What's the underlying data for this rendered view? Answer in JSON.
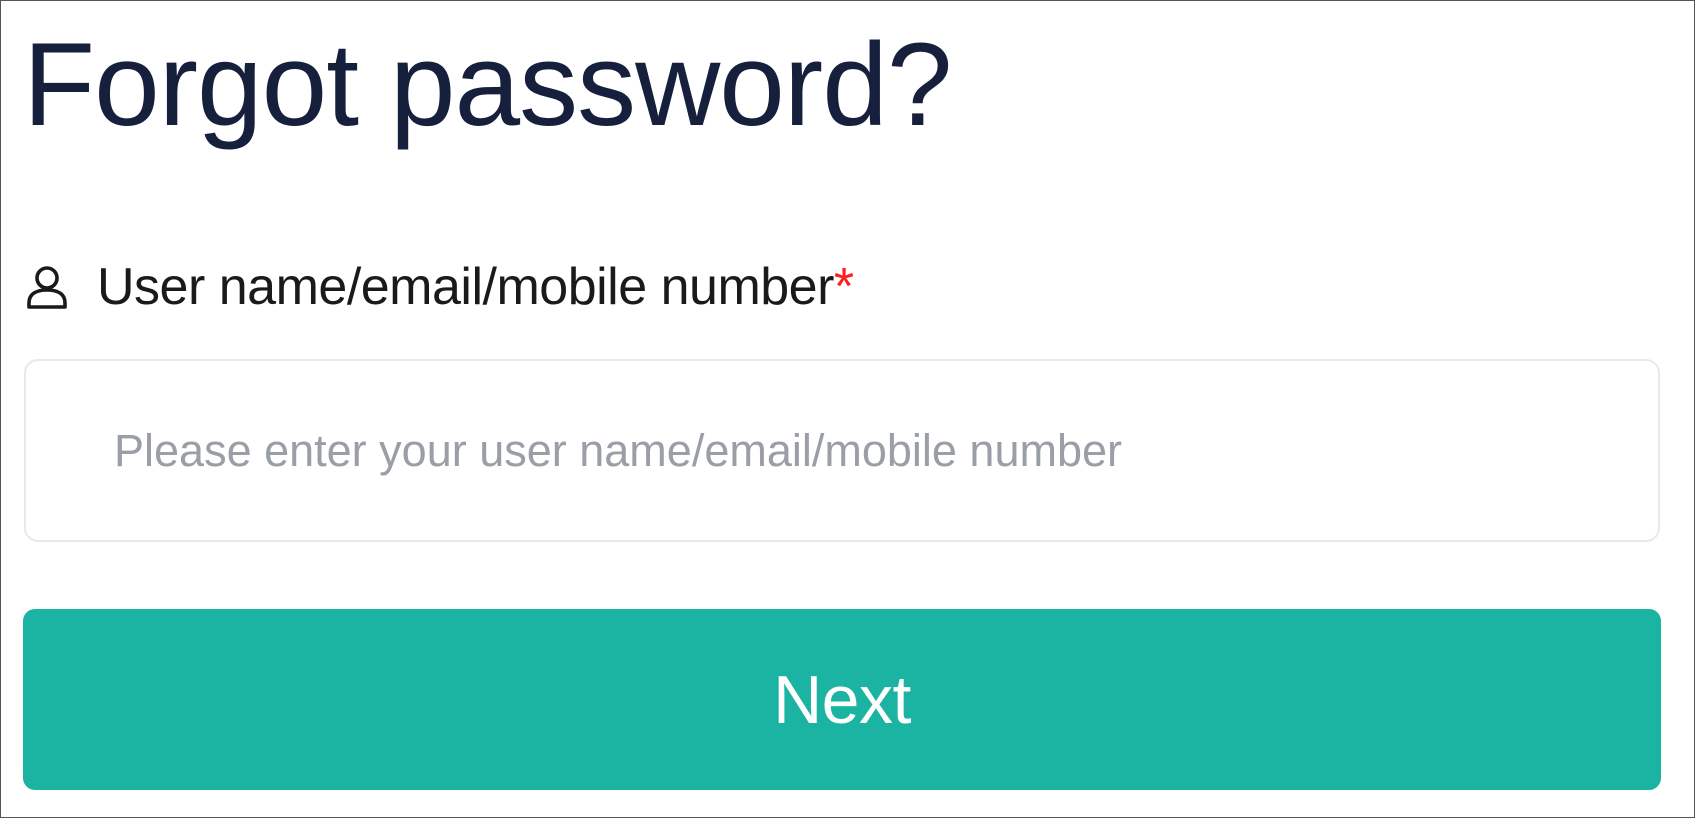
{
  "page": {
    "title": "Forgot password?"
  },
  "form": {
    "field_label": "User name/email/mobile number",
    "required_mark": "*",
    "field_icon": "user-icon",
    "input_value": "",
    "input_placeholder": "Please enter your user name/email/mobile number",
    "submit_label": "Next"
  },
  "colors": {
    "title": "#16203c",
    "label": "#1a1a1a",
    "required": "#ff1e1e",
    "button_bg": "#1bb3a1",
    "button_text": "#ffffff",
    "input_border": "#e6e9ed",
    "placeholder": "#9a9ea6"
  }
}
